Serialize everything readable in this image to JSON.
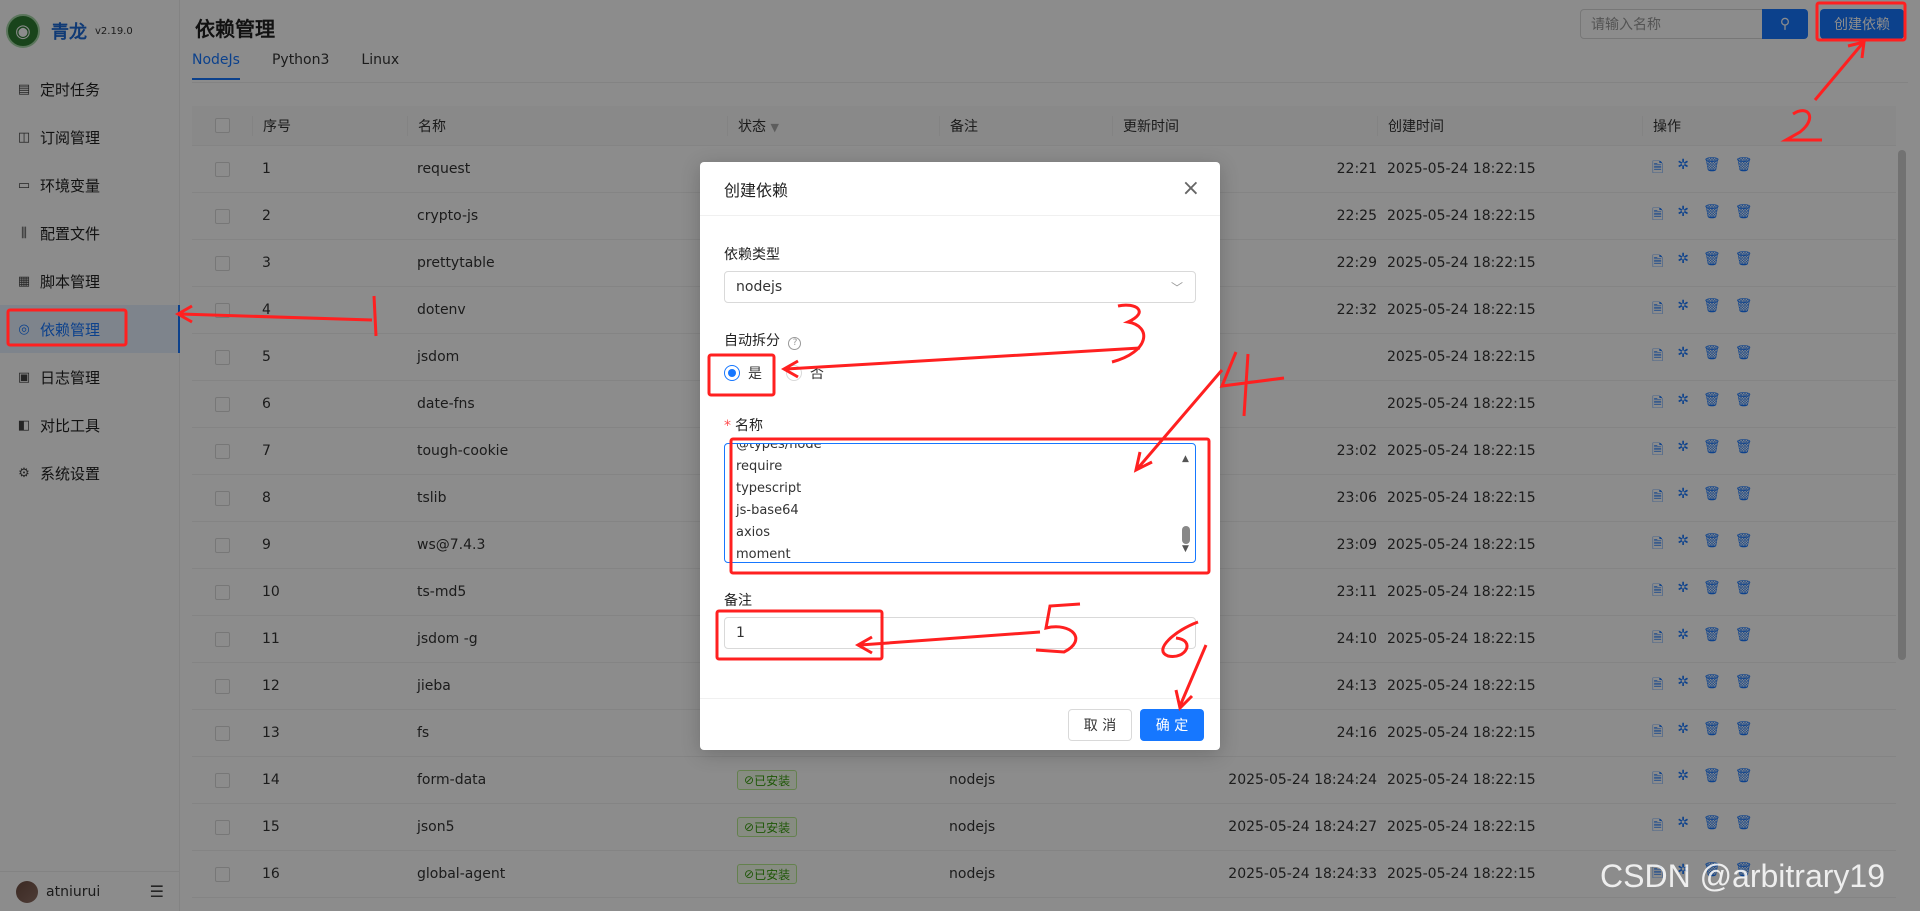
{
  "app": {
    "name": "青龙",
    "version": "v2.19.0"
  },
  "sidebar": {
    "items": [
      {
        "label": "定时任务",
        "icon": "calendar-icon"
      },
      {
        "label": "订阅管理",
        "icon": "subscribe-icon"
      },
      {
        "label": "环境变量",
        "icon": "monitor-icon"
      },
      {
        "label": "配置文件",
        "icon": "sliders-icon"
      },
      {
        "label": "脚本管理",
        "icon": "script-icon"
      },
      {
        "label": "依赖管理",
        "icon": "dependency-icon",
        "active": true
      },
      {
        "label": "日志管理",
        "icon": "log-icon"
      },
      {
        "label": "对比工具",
        "icon": "diff-icon"
      },
      {
        "label": "系统设置",
        "icon": "gear-icon"
      }
    ],
    "user": "atniurui"
  },
  "header": {
    "title": "依赖管理",
    "search_placeholder": "请输入名称",
    "create_label": "创建依赖"
  },
  "tabs": [
    {
      "label": "NodeJs",
      "active": true
    },
    {
      "label": "Python3"
    },
    {
      "label": "Linux"
    }
  ],
  "table": {
    "columns": [
      "序号",
      "名称",
      "状态",
      "备注",
      "更新时间",
      "创建时间",
      "操作"
    ],
    "rows": [
      {
        "no": "1",
        "name": "request",
        "status": "",
        "remark": "",
        "updated": "22:21",
        "created": "2025-05-24 18:22:15"
      },
      {
        "no": "2",
        "name": "crypto-js",
        "status": "",
        "remark": "",
        "updated": "22:25",
        "created": "2025-05-24 18:22:15"
      },
      {
        "no": "3",
        "name": "prettytable",
        "status": "",
        "remark": "",
        "updated": "22:29",
        "created": "2025-05-24 18:22:15"
      },
      {
        "no": "4",
        "name": "dotenv",
        "status": "",
        "remark": "",
        "updated": "22:32",
        "created": "2025-05-24 18:22:15"
      },
      {
        "no": "5",
        "name": "jsdom",
        "status": "",
        "remark": "",
        "updated": "",
        "created": "2025-05-24 18:22:15"
      },
      {
        "no": "6",
        "name": "date-fns",
        "status": "",
        "remark": "",
        "updated": "",
        "created": "2025-05-24 18:22:15"
      },
      {
        "no": "7",
        "name": "tough-cookie",
        "status": "",
        "remark": "",
        "updated": "23:02",
        "created": "2025-05-24 18:22:15"
      },
      {
        "no": "8",
        "name": "tslib",
        "status": "",
        "remark": "",
        "updated": "23:06",
        "created": "2025-05-24 18:22:15"
      },
      {
        "no": "9",
        "name": "ws@7.4.3",
        "status": "",
        "remark": "",
        "updated": "23:09",
        "created": "2025-05-24 18:22:15"
      },
      {
        "no": "10",
        "name": "ts-md5",
        "status": "",
        "remark": "",
        "updated": "23:11",
        "created": "2025-05-24 18:22:15"
      },
      {
        "no": "11",
        "name": "jsdom -g",
        "status": "",
        "remark": "",
        "updated": "24:10",
        "created": "2025-05-24 18:22:15"
      },
      {
        "no": "12",
        "name": "jieba",
        "status": "",
        "remark": "",
        "updated": "24:13",
        "created": "2025-05-24 18:22:15"
      },
      {
        "no": "13",
        "name": "fs",
        "status": "",
        "remark": "",
        "updated": "24:16",
        "created": "2025-05-24 18:22:15"
      },
      {
        "no": "14",
        "name": "form-data",
        "status": "已安装",
        "remark": "nodejs",
        "updated": "2025-05-24 18:24:24",
        "created": "2025-05-24 18:22:15"
      },
      {
        "no": "15",
        "name": "json5",
        "status": "已安装",
        "remark": "nodejs",
        "updated": "2025-05-24 18:24:27",
        "created": "2025-05-24 18:22:15"
      },
      {
        "no": "16",
        "name": "global-agent",
        "status": "已安装",
        "remark": "nodejs",
        "updated": "2025-05-24 18:24:33",
        "created": "2025-05-24 18:22:15"
      }
    ]
  },
  "modal": {
    "title": "创建依赖",
    "type_label": "依赖类型",
    "type_value": "nodejs",
    "split_label": "自动拆分",
    "split_yes": "是",
    "split_no": "否",
    "name_label": "名称",
    "name_lines": [
      "@types/node",
      "require",
      "typescript",
      "js-base64",
      "axios",
      "moment"
    ],
    "remark_label": "备注",
    "remark_value": "1",
    "cancel_label": "取 消",
    "ok_label": "确 定"
  },
  "annotations": [
    "1",
    "2",
    "3",
    "4",
    "5",
    "6"
  ],
  "watermark": "CSDN @arbitrary19"
}
